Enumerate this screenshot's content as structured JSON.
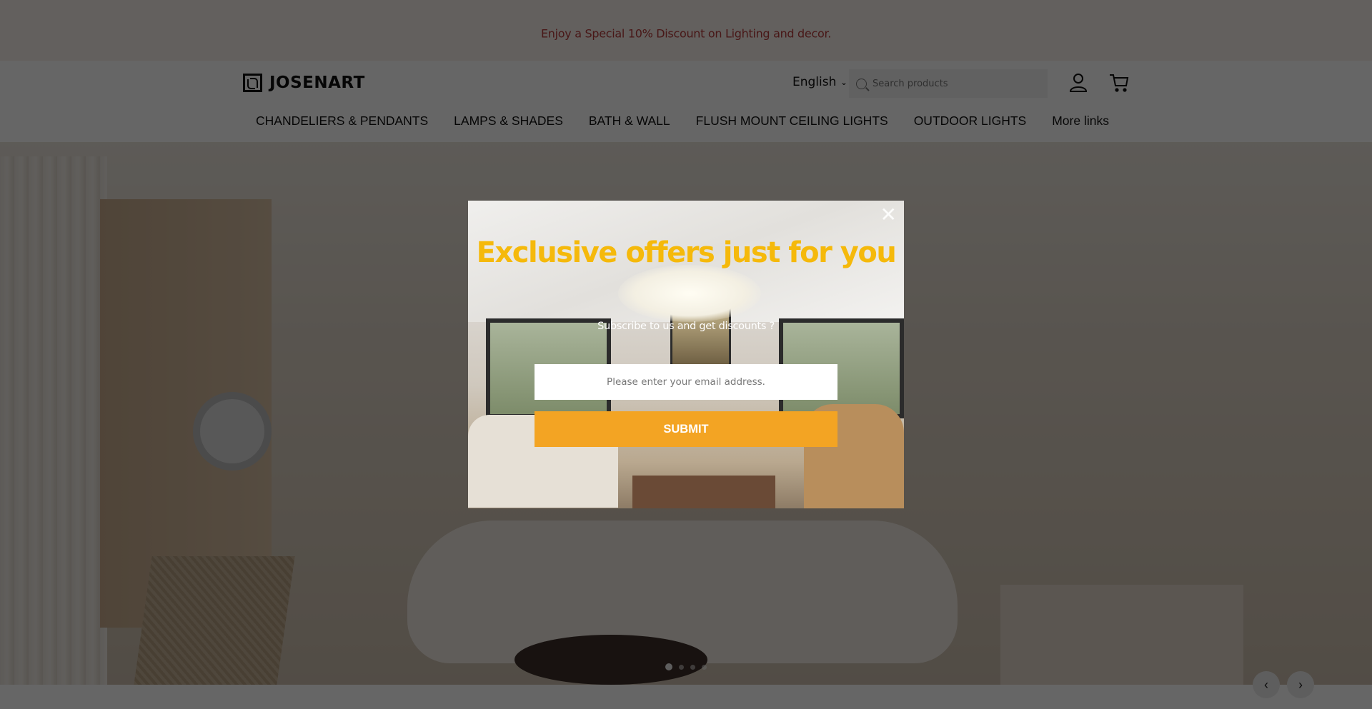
{
  "announcement": {
    "text": "Enjoy a Special 10% Discount on Lighting and decor."
  },
  "header": {
    "logo_text": "JOSENART",
    "logo_icon": "josenart-logo-mark",
    "language": {
      "selected": "English",
      "icon": "chevron-down-icon"
    },
    "search": {
      "placeholder": "Search products",
      "value": "",
      "icon": "search-icon"
    },
    "account_icon": "user-icon",
    "cart_icon": "cart-icon"
  },
  "nav": {
    "items": [
      {
        "label": "CHANDELIERS & PENDANTS"
      },
      {
        "label": "LAMPS & SHADES"
      },
      {
        "label": "BATH & WALL"
      },
      {
        "label": "FLUSH MOUNT CEILING LIGHTS"
      },
      {
        "label": "OUTDOOR LIGHTS"
      },
      {
        "label": "More links"
      }
    ]
  },
  "hero": {
    "slide_count": 4,
    "active_slide": 1,
    "prev_icon": "chevron-left-icon",
    "next_icon": "chevron-right-icon",
    "prev_glyph": "‹",
    "next_glyph": "›"
  },
  "popup": {
    "close_glyph": "✕",
    "title": "Exclusive offers just for you",
    "subtitle": "Subscribe to us and get discounts ?",
    "email_placeholder": "Please enter your email address.",
    "email_value": "",
    "submit_label": "SUBMIT",
    "colors": {
      "title": "#f5b90b",
      "submit_bg": "#f3a423"
    }
  },
  "colors": {
    "announcement_text": "#b53a3a",
    "overlay": "rgba(0,0,0,0.6)"
  }
}
